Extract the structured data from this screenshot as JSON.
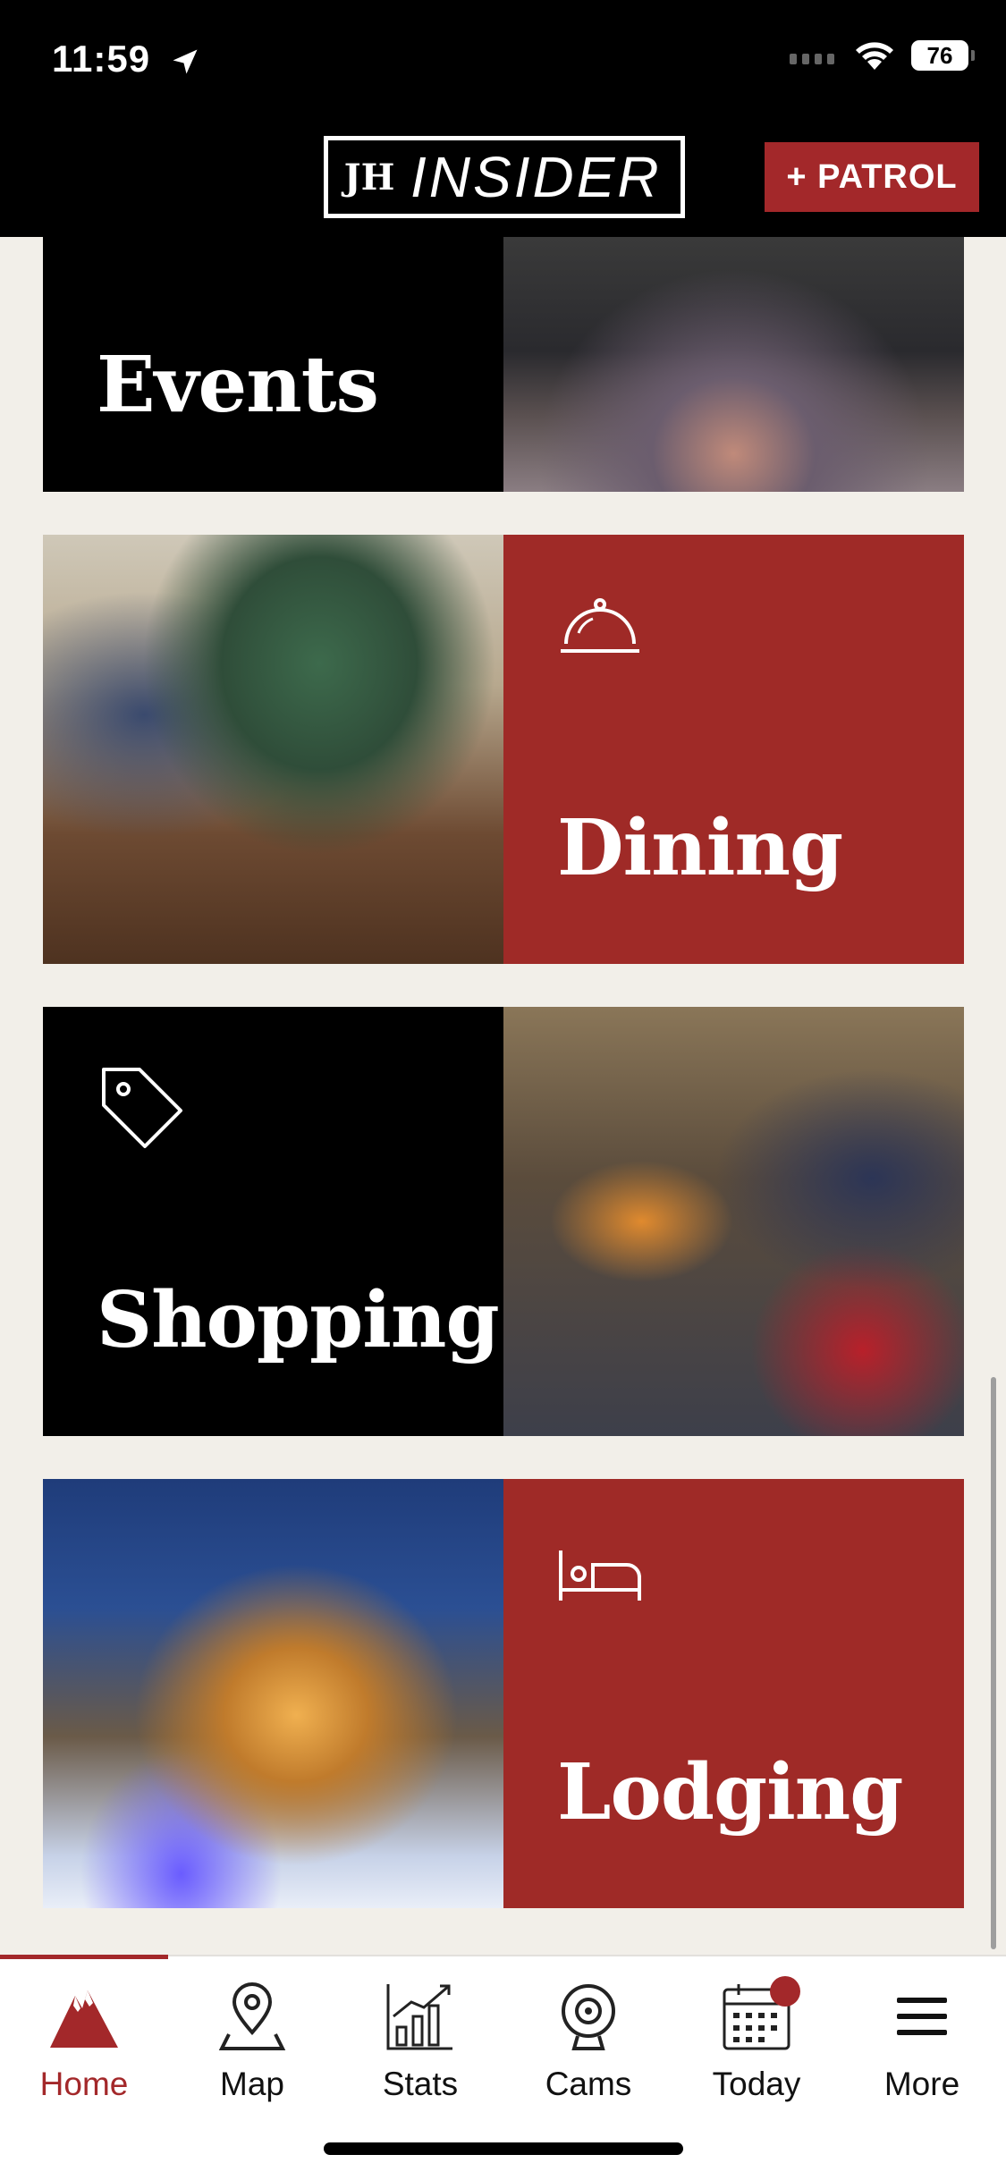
{
  "status": {
    "time": "11:59",
    "battery": "76"
  },
  "header": {
    "logo_mark": "JH",
    "logo_text": "INSIDER",
    "patrol_label": "+ PATROL"
  },
  "tiles": [
    {
      "label": "Events",
      "icon": "none",
      "photo": "music-festival-photo"
    },
    {
      "label": "Dining",
      "icon": "service-bell-icon",
      "photo": "dining-photo"
    },
    {
      "label": "Shopping",
      "icon": "price-tag-icon",
      "photo": "shopping-photo"
    },
    {
      "label": "Lodging",
      "icon": "bed-icon",
      "photo": "lodging-photo"
    }
  ],
  "tabs": [
    {
      "label": "Home",
      "icon": "mountain-icon",
      "active": true
    },
    {
      "label": "Map",
      "icon": "map-pin-icon"
    },
    {
      "label": "Stats",
      "icon": "chart-icon"
    },
    {
      "label": "Cams",
      "icon": "webcam-icon"
    },
    {
      "label": "Today",
      "icon": "calendar-icon",
      "badge": true
    },
    {
      "label": "More",
      "icon": "menu-icon"
    }
  ],
  "colors": {
    "accent": "#a3282a",
    "tile_red": "#9f2a27",
    "background": "#f2efe9"
  }
}
